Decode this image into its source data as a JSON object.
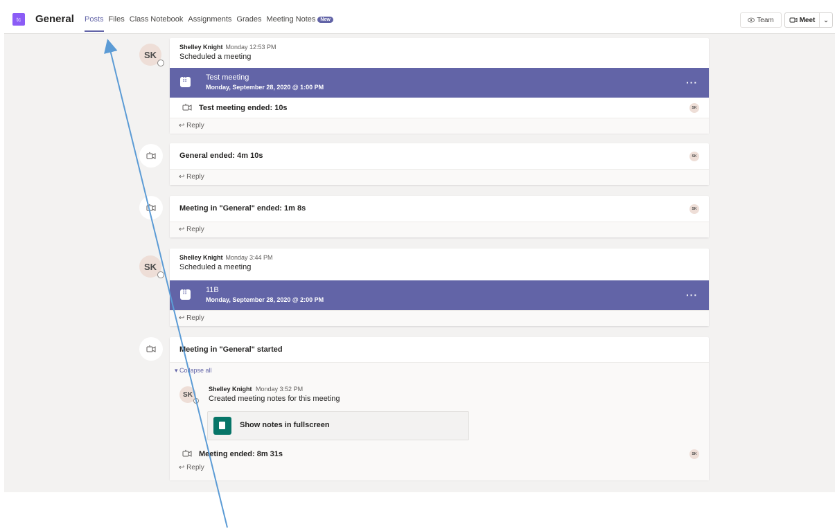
{
  "header": {
    "team_tile": "tc",
    "channel": "General",
    "tabs": [
      {
        "label": "Posts",
        "active": true
      },
      {
        "label": "Files"
      },
      {
        "label": "Class Notebook"
      },
      {
        "label": "Assignments"
      },
      {
        "label": "Grades"
      },
      {
        "label": "Meeting Notes"
      }
    ],
    "new_badge": "New",
    "team_button": "Team",
    "meet_button": "Meet"
  },
  "posts": {
    "p1": {
      "avatar": "SK",
      "author": "Shelley Knight",
      "time": "Monday 12:53 PM",
      "subtitle": "Scheduled a meeting",
      "meeting_title": "Test meeting",
      "meeting_date": "Monday, September 28, 2020 @ 1:00 PM",
      "ended": "Test meeting ended: 10s",
      "participant": "SK",
      "reply": "Reply"
    },
    "p2": {
      "title": "General ended: 4m 10s",
      "participant": "SK",
      "reply": "Reply"
    },
    "p3": {
      "title": "Meeting in \"General\" ended: 1m 8s",
      "participant": "SK",
      "reply": "Reply"
    },
    "p4": {
      "avatar": "SK",
      "author": "Shelley Knight",
      "time": "Monday 3:44 PM",
      "subtitle": "Scheduled a meeting",
      "meeting_title": "11B",
      "meeting_date": "Monday, September 28, 2020 @ 2:00 PM",
      "reply": "Reply"
    },
    "p5": {
      "title": "Meeting in \"General\" started",
      "collapse": "Collapse all",
      "sub_avatar": "SK",
      "sub_author": "Shelley Knight",
      "sub_time": "Monday 3:52 PM",
      "sub_text": "Created meeting notes for this meeting",
      "notes_button": "Show notes in fullscreen",
      "ended": "Meeting ended: 8m 31s",
      "participant": "SK",
      "reply": "Reply"
    }
  },
  "colors": {
    "accent": "#6264a7",
    "notes_green": "#077568",
    "annotation_arrow": "#5b9bd5"
  }
}
